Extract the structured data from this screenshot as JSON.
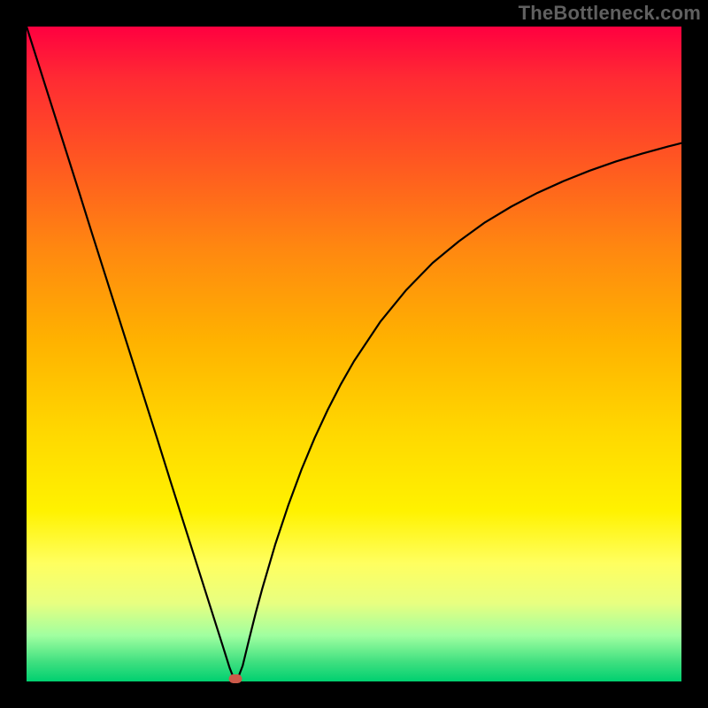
{
  "watermark": "TheBottleneck.com",
  "chart_data": {
    "type": "line",
    "title": "",
    "xlabel": "",
    "ylabel": "",
    "xlim": [
      0,
      100
    ],
    "ylim": [
      0,
      100
    ],
    "series": [
      {
        "name": "curve",
        "x": [
          0.0,
          2.0,
          4.0,
          6.0,
          8.0,
          10.0,
          12.0,
          14.0,
          16.0,
          18.0,
          20.0,
          22.0,
          24.0,
          26.0,
          28.0,
          30.0,
          31.0,
          31.7,
          32.2,
          33.0,
          34.0,
          35.0,
          36.0,
          38.0,
          40.0,
          42.0,
          44.0,
          46.0,
          48.0,
          50.0,
          54.0,
          58.0,
          62.0,
          66.0,
          70.0,
          74.0,
          78.0,
          82.0,
          86.0,
          90.0,
          94.0,
          98.0,
          100.0
        ],
        "y": [
          100.0,
          93.7,
          87.4,
          81.1,
          74.8,
          68.4,
          62.1,
          55.8,
          49.5,
          43.2,
          36.9,
          30.5,
          24.2,
          17.9,
          11.6,
          5.3,
          2.1,
          0.3,
          0.3,
          2.4,
          6.5,
          10.5,
          14.2,
          21.0,
          27.0,
          32.4,
          37.2,
          41.5,
          45.4,
          48.9,
          54.9,
          59.8,
          63.9,
          67.2,
          70.1,
          72.5,
          74.6,
          76.4,
          78.0,
          79.4,
          80.6,
          81.7,
          82.2
        ]
      }
    ],
    "annotations": [
      {
        "name": "minimum-marker",
        "x": 31.9,
        "y": 0.4,
        "shape": "pill",
        "color": "#cc5a4a"
      }
    ],
    "background": {
      "type": "vertical-gradient",
      "stops": [
        {
          "pos": 0.0,
          "color": "#ff0040"
        },
        {
          "pos": 0.5,
          "color": "#ffc800"
        },
        {
          "pos": 0.8,
          "color": "#ffff60"
        },
        {
          "pos": 1.0,
          "color": "#00d070"
        }
      ]
    }
  },
  "layout": {
    "image_size": 800,
    "plot_left": 30,
    "plot_top": 30,
    "plot_size": 740
  }
}
